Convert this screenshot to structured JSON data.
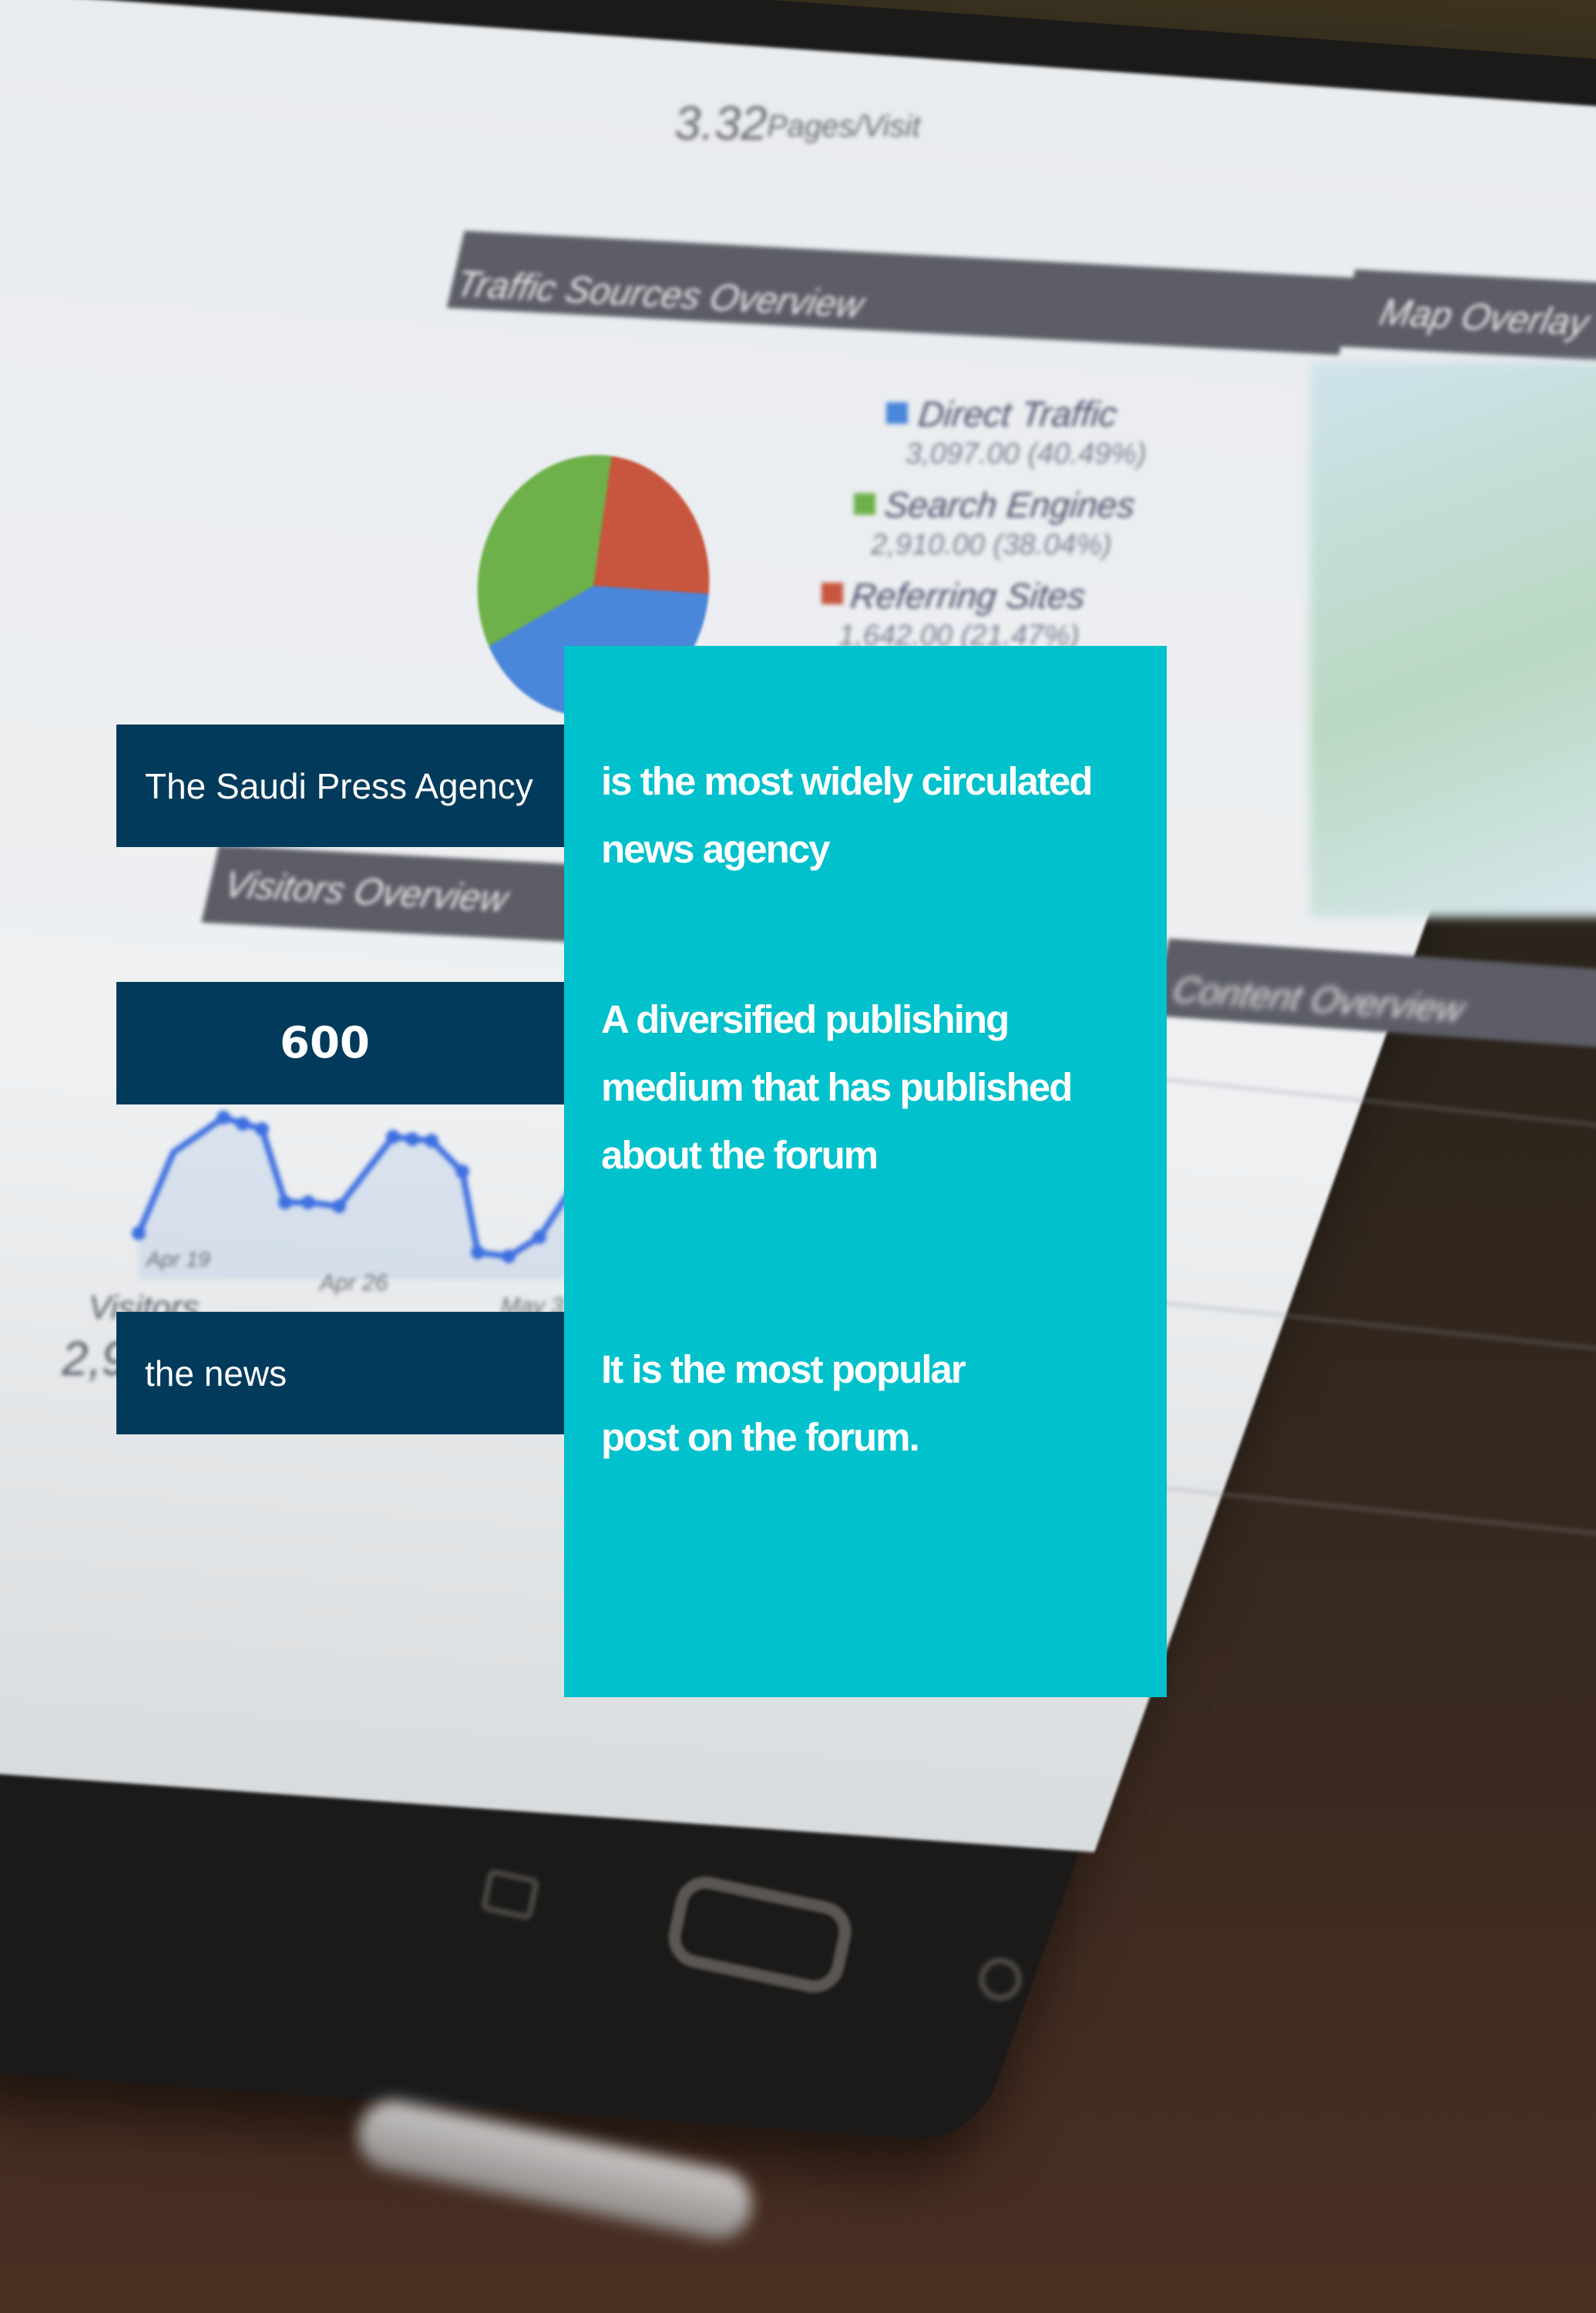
{
  "background": {
    "description_icon": "tablet-analytics-photo",
    "dashboard": {
      "pages_visit_value": "3.32",
      "pages_visit_label": "Pages/Visit",
      "traffic_header": "Traffic Sources Overview",
      "map_header": "Map Overlay",
      "visitors_header": "Visitors Overview",
      "content_header": "Content Overview",
      "legend": [
        {
          "name": "Direct Traffic",
          "value": "3,097.00 (40.49%)",
          "color": "#4a86d9"
        },
        {
          "name": "Search Engines",
          "value": "2,910.00 (38.04%)",
          "color": "#6eb04a"
        },
        {
          "name": "Referring Sites",
          "value": "1,642.00 (21.47%)",
          "color": "#c8553d"
        }
      ],
      "axis_dates": [
        "Apr 19",
        "Apr 26",
        "May 3"
      ],
      "visitors_label": "Visitors",
      "visitors_value": "2,9"
    }
  },
  "overlay": {
    "agency_label": "The Saudi Press Agency",
    "count_value": "600",
    "news_label": "the news",
    "teal_paragraphs": [
      [
        "is the most widely circulated",
        "news agency"
      ],
      [
        "A diversified publishing",
        "medium that has published",
        "about the forum"
      ],
      [
        "It is the most popular",
        "post on the forum."
      ]
    ],
    "colors": {
      "navy": "#023a5c",
      "teal": "#00c1cc"
    }
  }
}
